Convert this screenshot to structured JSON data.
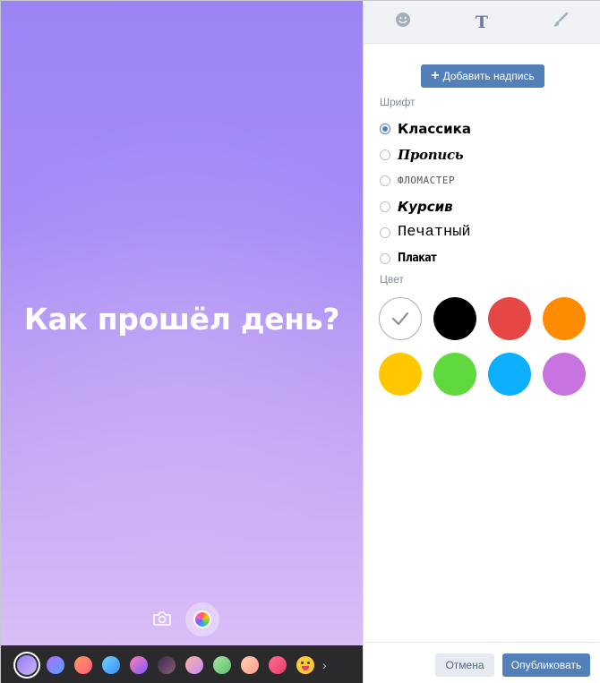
{
  "canvas": {
    "text": "Как прошёл день?",
    "gradient_top": "#9b84f5",
    "gradient_bottom": "#d9bdf6",
    "tools": [
      "camera-icon",
      "palette-icon"
    ]
  },
  "backgrounds": [
    {
      "name": "lavender",
      "colors": [
        "#8e7bf3",
        "#cdb4f6"
      ],
      "selected": true
    },
    {
      "name": "purple-blue",
      "colors": [
        "#b36bff",
        "#4fa3ff"
      ]
    },
    {
      "name": "orange-pink",
      "colors": [
        "#ff9a5a",
        "#ff5f7e"
      ]
    },
    {
      "name": "sky-blue",
      "colors": [
        "#6fd3ff",
        "#3a8cff"
      ]
    },
    {
      "name": "sunset",
      "colors": [
        "#ff7eb3",
        "#7a5cff"
      ]
    },
    {
      "name": "dark-night",
      "colors": [
        "#3a2a4a",
        "#8a5a7a"
      ]
    },
    {
      "name": "peach-lilac",
      "colors": [
        "#ffb3a0",
        "#c38bff"
      ]
    },
    {
      "name": "green",
      "colors": [
        "#a8e6a3",
        "#5bbf6a"
      ]
    },
    {
      "name": "peach",
      "colors": [
        "#ffd1b3",
        "#ff9f8a"
      ]
    },
    {
      "name": "pink-red",
      "colors": [
        "#ff6f91",
        "#e83a6a"
      ]
    },
    {
      "name": "emoji",
      "emoji": true
    }
  ],
  "panel": {
    "tabs": [
      {
        "name": "stickers",
        "icon": "smile-icon"
      },
      {
        "name": "text",
        "label": "T",
        "active": true
      },
      {
        "name": "draw",
        "icon": "brush-icon"
      }
    ],
    "add_caption_label": "Добавить надпись",
    "font_section_label": "Шрифт",
    "fonts": [
      {
        "label": "Классика",
        "style": "f-classic",
        "checked": true
      },
      {
        "label": "Пропись",
        "style": "f-script",
        "checked": false
      },
      {
        "label": "ФЛОМАСТЕР",
        "style": "f-marker",
        "checked": false
      },
      {
        "label": "Курсив",
        "style": "f-italic",
        "checked": false
      },
      {
        "label": "Печатный",
        "style": "f-typewriter",
        "checked": false
      },
      {
        "label": "Плакат",
        "style": "f-poster",
        "checked": false
      }
    ],
    "color_section_label": "Цвет",
    "colors": [
      {
        "name": "white",
        "hex": "#ffffff",
        "selected": true
      },
      {
        "name": "black",
        "hex": "#000000"
      },
      {
        "name": "red",
        "hex": "#e64646"
      },
      {
        "name": "orange",
        "hex": "#ff8c00"
      },
      {
        "name": "yellow",
        "hex": "#ffc700"
      },
      {
        "name": "green",
        "hex": "#5fd93d"
      },
      {
        "name": "blue",
        "hex": "#0cb0ff"
      },
      {
        "name": "purple",
        "hex": "#c774e0"
      }
    ],
    "cancel_label": "Отмена",
    "publish_label": "Опубликовать"
  }
}
